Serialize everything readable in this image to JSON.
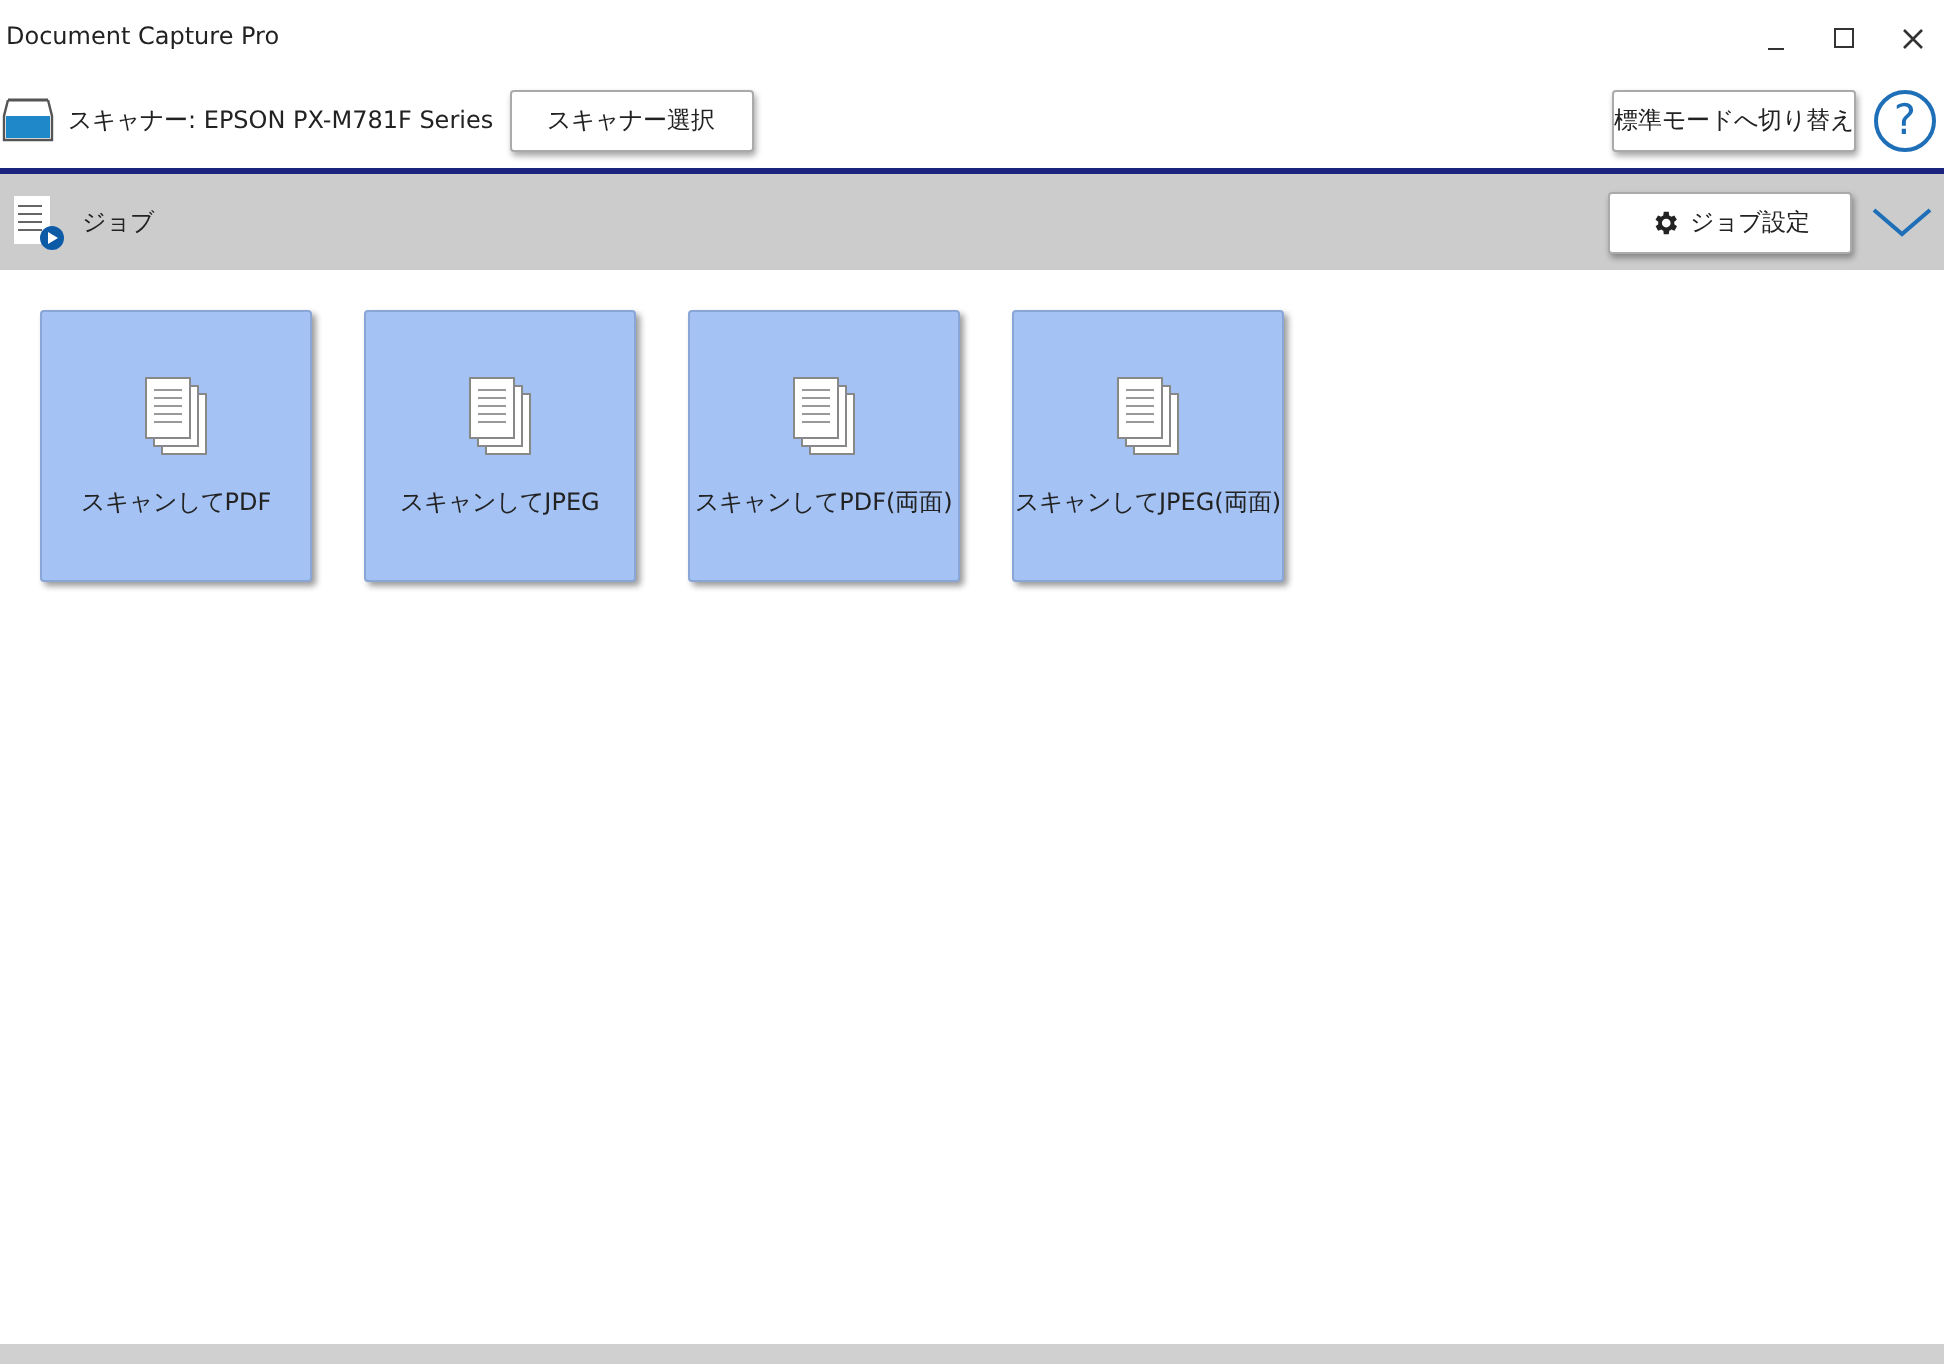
{
  "window": {
    "title": "Document Capture Pro"
  },
  "toolbar": {
    "scanner_label": "スキャナー: EPSON PX-M781F Series",
    "scanner_button": "スキャナー選択",
    "mode_button": "標準モードへ切り替え",
    "help": "?"
  },
  "job_bar": {
    "title": "ジョブ",
    "settings_button": "ジョブ設定"
  },
  "jobs": [
    {
      "label": "スキャンしてPDF"
    },
    {
      "label": "スキャンしてJPEG"
    },
    {
      "label": "スキャンしてPDF(両面)"
    },
    {
      "label": "スキャンしてJPEG(両面)"
    }
  ]
}
